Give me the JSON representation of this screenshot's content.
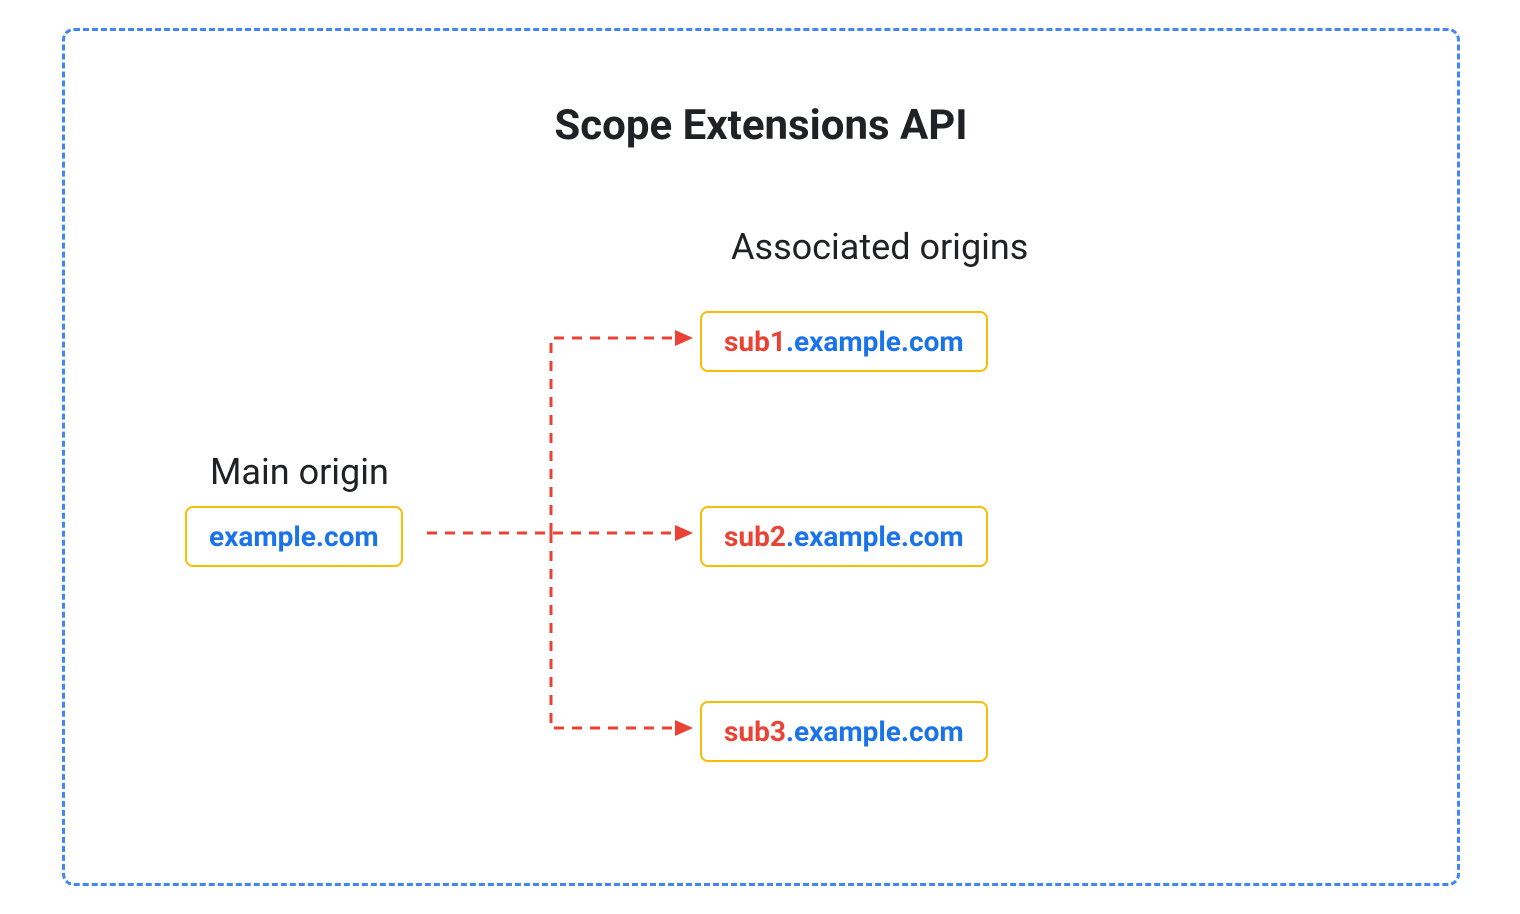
{
  "title": "Scope Extensions API",
  "mainOrigin": {
    "label": "Main origin",
    "domain": "example.com"
  },
  "associatedOrigins": {
    "label": "Associated origins",
    "items": [
      {
        "subdomain": "sub1",
        "domain": ".example.com"
      },
      {
        "subdomain": "sub2",
        "domain": ".example.com"
      },
      {
        "subdomain": "sub3",
        "domain": ".example.com"
      }
    ]
  },
  "colors": {
    "borderBlue": "#4285f4",
    "boxOrange": "#fbbc04",
    "textBlue": "#1a73e8",
    "textRed": "#ea4335",
    "arrowRed": "#ea4335"
  }
}
